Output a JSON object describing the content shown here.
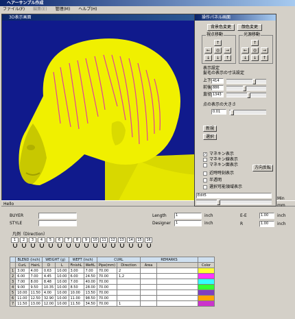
{
  "app_title": "ヘアーサンプル作成",
  "menu": [
    "ファイル(F)",
    "編集(E)",
    "管理(M)",
    "ヘルプ(H)"
  ],
  "view_title": "3D表示画面",
  "status_text": "Hello",
  "panel": {
    "title": "操作パネル画面",
    "btn_background": "背景色変更",
    "btn_color": "顔色変更",
    "group_view": "視点移動",
    "group_light": "光源移動",
    "arrow_up": "↑",
    "arrow_down": "↓",
    "arrow_left": "←",
    "arrow_right": "→",
    "center_symbol": "◎",
    "display_settings": "表示設定",
    "scale_label": "髪毛の表示の寸法設定",
    "field_top_label": "上下",
    "field_top_value": "414",
    "field_front_label": "前後",
    "field_front_value": "886",
    "field_right_label": "直径",
    "field_right_value": "1343",
    "dot_size_label": "点の表示の大きさ",
    "dot_size_value": "0.01",
    "btn_new": "新規",
    "btn_select": "選択",
    "chk_mannequin_show": "マネキン表示",
    "chk_mannequin_line": "マネキン線表示",
    "chk_mannequin_face": "マネキン面表示",
    "chk_approx": "近時時刻表示",
    "chk_semi": "半透明",
    "chk_select": "選択可能領域表示",
    "btn_direction": "方向反転",
    "edit_value": "Edit5",
    "min_label": "Min",
    "mm_label": "mm",
    "checked_symbol": "✓"
  },
  "form": {
    "buyer_label": "BUYER",
    "style_label": "STYLE",
    "length_label": "Length",
    "length_value": "1",
    "length_unit": "inch",
    "designer_label": "Designer",
    "designer_value": "1",
    "designer_unit": "inch",
    "ee_label": "E-E",
    "ee_value": "1.00",
    "ee_unit": "inch",
    "r_label": "R",
    "r_value": "1.00",
    "r_unit": "inch",
    "direction_label": "凡例（Direction）",
    "direction_numbers": [
      "1",
      "2",
      "3",
      "4",
      "5",
      "6",
      "7",
      "8",
      "9",
      "10",
      "11",
      "12",
      "13",
      "14",
      "15",
      "16"
    ]
  },
  "table": {
    "group_headers": [
      "BLEND (inch)",
      "WEIGHT (g)",
      "WEFT (inch)",
      "CURL",
      "REMARKS"
    ],
    "columns": [
      "",
      "CurL",
      "HairL",
      "D",
      "L",
      "FinishL",
      "WeftL",
      "Pipe(mm)",
      "Direction",
      "Area",
      "",
      "Color"
    ],
    "rows": [
      [
        "1",
        "3.00",
        "4.00",
        "0.63",
        "10.00",
        "3.00",
        "7.00",
        "70.00",
        "2",
        "",
        ""
      ],
      [
        "2",
        "6.00",
        "7.00",
        "4.45",
        "10.00",
        "6.00",
        "24.50",
        "70.00",
        "1,2",
        "",
        ""
      ],
      [
        "3",
        "7.00",
        "8.00",
        "8.48",
        "10.00",
        "7.00",
        "40.00",
        "70.00",
        "",
        "",
        ""
      ],
      [
        "4",
        "9.00",
        "9.50",
        "10.35",
        "10.00",
        "8.50",
        "28.00",
        "70.00",
        "",
        "",
        ""
      ],
      [
        "5",
        "10.00",
        "11.50",
        "4.00",
        "10.00",
        "10.00",
        "13.50",
        "70.00",
        "",
        "",
        ""
      ],
      [
        "6",
        "11.00",
        "12.50",
        "32.90",
        "10.00",
        "11.00",
        "98.50",
        "70.00",
        "",
        "",
        ""
      ],
      [
        "7",
        "11.50",
        "13.00",
        "12.00",
        "10.00",
        "11.50",
        "34.50",
        "70.00",
        "1",
        "",
        ""
      ]
    ],
    "row_colors": [
      "#ffff33",
      "#ff33ff",
      "#33ffff",
      "#33ff33",
      "#7f3fbf",
      "#ffa500",
      "#cc33cc"
    ]
  }
}
